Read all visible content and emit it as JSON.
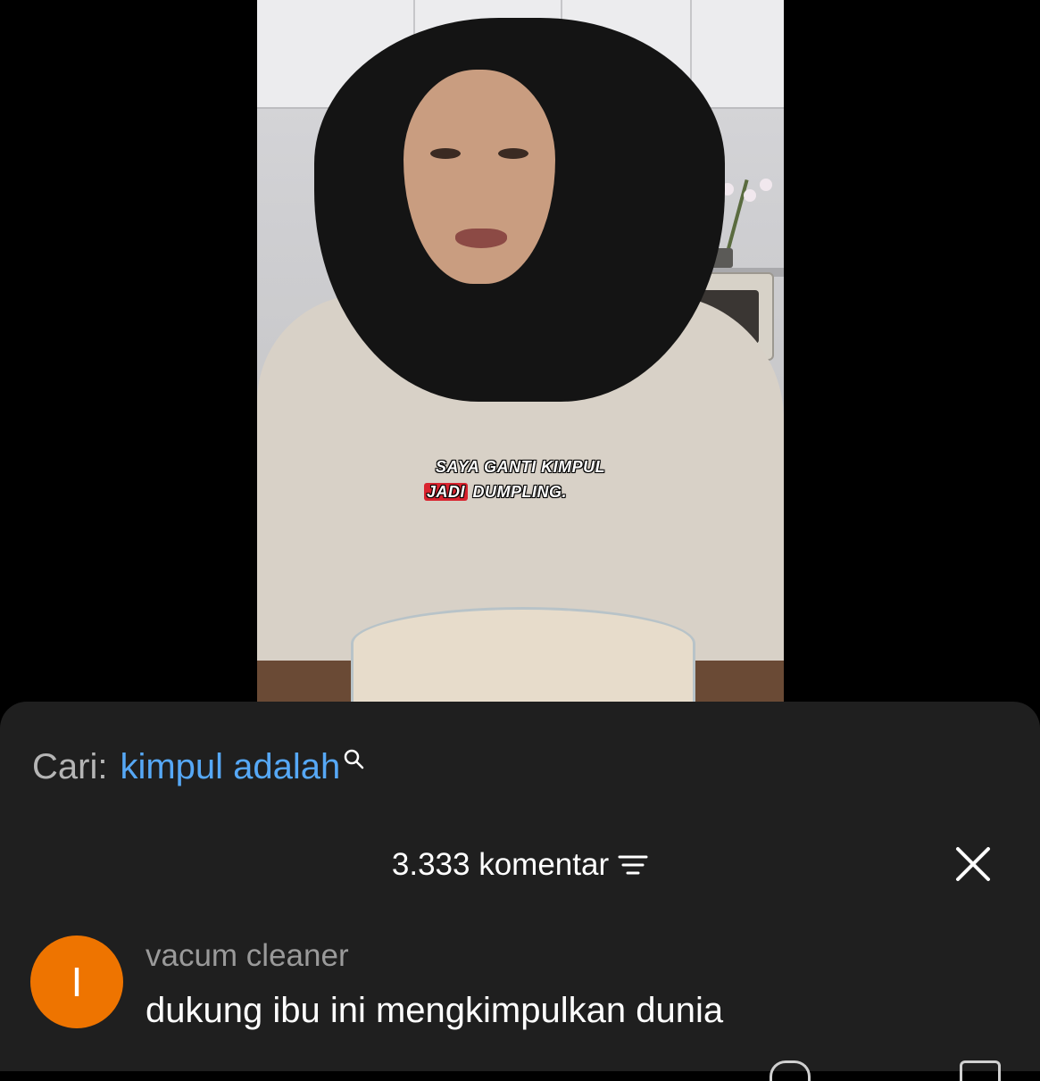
{
  "video": {
    "caption_line1": "SAYA GANTI KIMPUL",
    "caption_line2_highlight": "JADI",
    "caption_line2_rest": "DUMPLING."
  },
  "search": {
    "label": "Cari:",
    "query": "kimpul adalah",
    "icon": "search-icon"
  },
  "comments": {
    "count_text": "3.333 komentar",
    "sort_icon": "sort-icon",
    "close_icon": "close-icon",
    "items": [
      {
        "avatar_letter": "I",
        "avatar_color": "#EE7400",
        "username": "vacum cleaner",
        "text": "dukung ibu ini mengkimpulkan dunia"
      }
    ]
  },
  "colors": {
    "sheet_bg": "#1F1F1F",
    "search_query": "#56A8F6",
    "caption_highlight": "#D9232E"
  }
}
